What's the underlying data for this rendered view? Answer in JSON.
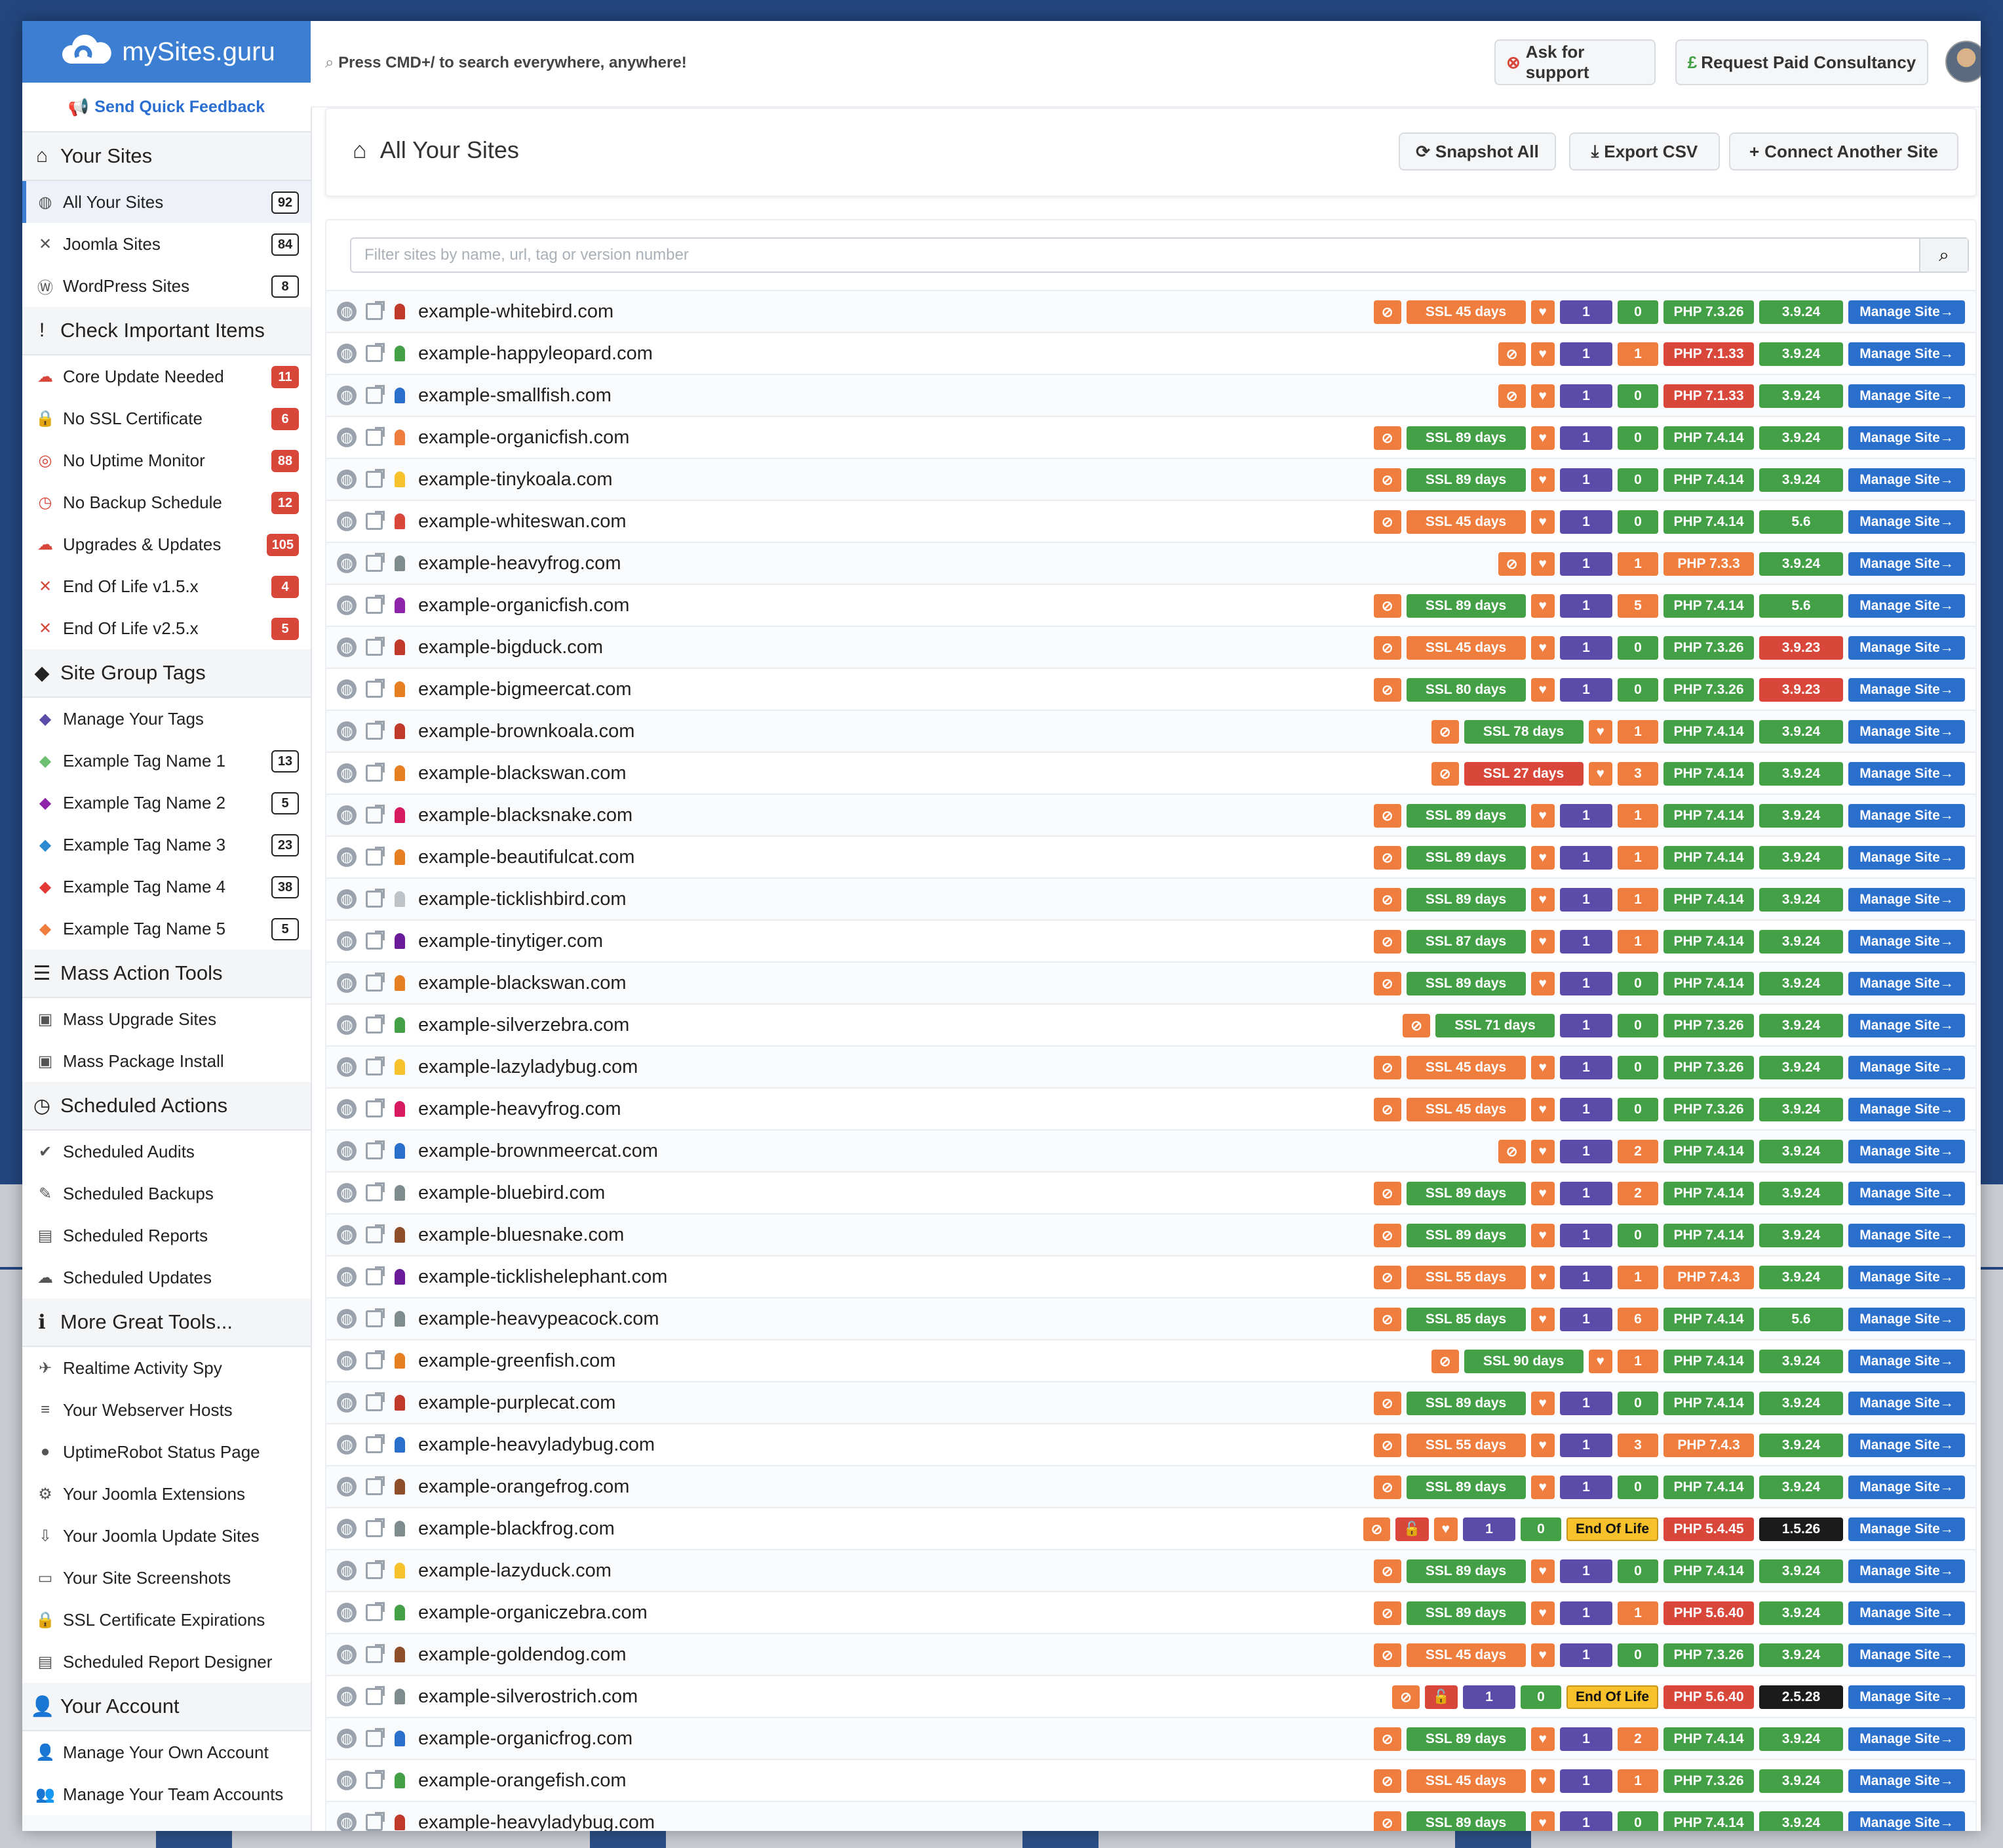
{
  "app": {
    "brand": "mySites.guru",
    "feedback": "Send Quick Feedback",
    "search_hint": "Press CMD+/ to search everywhere, anywhere!",
    "ask_support": "Ask for support",
    "paid_consultancy": "Request Paid Consultancy"
  },
  "sidebar": {
    "sections": [
      {
        "title": "Your Sites",
        "icon": "home-icon",
        "items": [
          {
            "label": "All Your Sites",
            "icon": "globe-icon",
            "count": "92",
            "active": true
          },
          {
            "label": "Joomla Sites",
            "icon": "joomla-icon",
            "count": "84"
          },
          {
            "label": "WordPress Sites",
            "icon": "wordpress-icon",
            "count": "8"
          }
        ]
      },
      {
        "title": "Check Important Items",
        "icon": "exclamation-icon",
        "items": [
          {
            "label": "Core Update Needed",
            "icon": "cloud-up-icon",
            "count": "11",
            "red": true
          },
          {
            "label": "No SSL Certificate",
            "icon": "lock-icon",
            "count": "6",
            "red": true
          },
          {
            "label": "No Uptime Monitor",
            "icon": "target-icon",
            "count": "88",
            "red": true
          },
          {
            "label": "No Backup Schedule",
            "icon": "clock-icon",
            "count": "12",
            "red": true
          },
          {
            "label": "Upgrades & Updates",
            "icon": "cloud-up-icon",
            "count": "105",
            "red": true
          },
          {
            "label": "End Of Life v1.5.x",
            "icon": "joomla-icon",
            "count": "4",
            "red": true
          },
          {
            "label": "End Of Life v2.5.x",
            "icon": "joomla-icon",
            "count": "5",
            "red": true
          }
        ]
      },
      {
        "title": "Site Group Tags",
        "icon": "tags-icon",
        "items": [
          {
            "label": "Manage Your Tags",
            "icon": "tags-icon",
            "color": "#5b4ca9"
          },
          {
            "label": "Example Tag Name 1",
            "icon": "tag-icon",
            "count": "13",
            "color": "#6cc070"
          },
          {
            "label": "Example Tag Name 2",
            "icon": "tag-icon",
            "count": "5",
            "color": "#8e24aa"
          },
          {
            "label": "Example Tag Name 3",
            "icon": "tag-icon",
            "count": "23",
            "color": "#2b8ad0"
          },
          {
            "label": "Example Tag Name 4",
            "icon": "tag-icon",
            "count": "38",
            "color": "#e53935"
          },
          {
            "label": "Example Tag Name 5",
            "icon": "tag-icon",
            "count": "5",
            "color": "#ef7d3d"
          }
        ]
      },
      {
        "title": "Mass Action Tools",
        "icon": "list-icon",
        "items": [
          {
            "label": "Mass Upgrade Sites",
            "icon": "upgrade-icon"
          },
          {
            "label": "Mass Package Install",
            "icon": "package-icon"
          }
        ]
      },
      {
        "title": "Scheduled Actions",
        "icon": "clock-icon",
        "items": [
          {
            "label": "Scheduled Audits",
            "icon": "shield-check-icon"
          },
          {
            "label": "Scheduled Backups",
            "icon": "backup-icon"
          },
          {
            "label": "Scheduled Reports",
            "icon": "report-icon"
          },
          {
            "label": "Scheduled Updates",
            "icon": "cloud-up-icon"
          }
        ]
      },
      {
        "title": "More Great Tools...",
        "icon": "info-icon",
        "items": [
          {
            "label": "Realtime Activity Spy",
            "icon": "telescope-icon"
          },
          {
            "label": "Your Webserver Hosts",
            "icon": "server-icon"
          },
          {
            "label": "UptimeRobot Status Page",
            "icon": "circle-icon"
          },
          {
            "label": "Your Joomla Extensions",
            "icon": "extensions-icon"
          },
          {
            "label": "Your Joomla Update Sites",
            "icon": "update-sites-icon"
          },
          {
            "label": "Your Site Screenshots",
            "icon": "screenshot-icon"
          },
          {
            "label": "SSL Certificate Expirations",
            "icon": "lock-icon"
          },
          {
            "label": "Scheduled Report Designer",
            "icon": "report-icon"
          }
        ]
      },
      {
        "title": "Your Account",
        "icon": "user-icon",
        "items": [
          {
            "label": "Manage Your Own Account",
            "icon": "user-icon"
          },
          {
            "label": "Manage Your Team Accounts",
            "icon": "users-icon"
          }
        ]
      }
    ]
  },
  "main": {
    "title": "All Your Sites",
    "snapshot_all": "Snapshot All",
    "export_csv": "Export CSV",
    "connect": "Connect Another Site",
    "filter_placeholder": "Filter sites by name, url, tag or version number",
    "manage_label": "Manage Site"
  },
  "sites": [
    {
      "url": "example-whitebird.com",
      "pin": "#c0392b",
      "ssl": "SSL 45 days",
      "sslc": "or",
      "tag": "1",
      "ext": "0",
      "extc": "gr",
      "php": "PHP 7.3.26",
      "phpc": "gr",
      "ver": "3.9.24",
      "verc": "gr"
    },
    {
      "url": "example-happyleopard.com",
      "pin": "#43a047",
      "ssl": null,
      "tag": "1",
      "ext": "1",
      "extc": "or",
      "php": "PHP 7.1.33",
      "phpc": "rd",
      "ver": "3.9.24",
      "verc": "gr"
    },
    {
      "url": "example-smallfish.com",
      "pin": "#2b6fcd",
      "ssl": null,
      "tag": "1",
      "ext": "0",
      "extc": "gr",
      "php": "PHP 7.1.33",
      "phpc": "rd",
      "ver": "3.9.24",
      "verc": "gr"
    },
    {
      "url": "example-organicfish.com",
      "pin": "#ef7d3d",
      "ssl": "SSL 89 days",
      "sslc": "gr",
      "tag": "1",
      "ext": "0",
      "extc": "gr",
      "php": "PHP 7.4.14",
      "phpc": "gr",
      "ver": "3.9.24",
      "verc": "gr"
    },
    {
      "url": "example-tinykoala.com",
      "pin": "#f7c12b",
      "ssl": "SSL 89 days",
      "sslc": "gr",
      "tag": "1",
      "ext": "0",
      "extc": "gr",
      "php": "PHP 7.4.14",
      "phpc": "gr",
      "ver": "3.9.24",
      "verc": "gr"
    },
    {
      "url": "example-whiteswan.com",
      "pin": "#d9463a",
      "ssl": "SSL 45 days",
      "sslc": "or",
      "tag": "1",
      "ext": "0",
      "extc": "gr",
      "php": "PHP 7.4.14",
      "phpc": "gr",
      "ver": "5.6",
      "verc": "gr",
      "wp": true
    },
    {
      "url": "example-heavyfrog.com",
      "pin": "#7f8c8d",
      "ssl": null,
      "tag": "1",
      "ext": "1",
      "extc": "or",
      "php": "PHP 7.3.3",
      "phpc": "or",
      "ver": "3.9.24",
      "verc": "gr"
    },
    {
      "url": "example-organicfish.com",
      "pin": "#8e24aa",
      "ssl": "SSL 89 days",
      "sslc": "gr",
      "tag": "1",
      "ext": "5",
      "extc": "or",
      "refresh": true,
      "php": "PHP 7.4.14",
      "phpc": "gr",
      "ver": "5.6",
      "verc": "gr",
      "wp": true
    },
    {
      "url": "example-bigduck.com",
      "pin": "#c0392b",
      "ssl": "SSL 45 days",
      "sslc": "or",
      "tag": "1",
      "ext": "0",
      "extc": "gr",
      "php": "PHP 7.3.26",
      "phpc": "gr",
      "ver": "3.9.23",
      "verc": "rd"
    },
    {
      "url": "example-bigmeercat.com",
      "pin": "#e67e22",
      "ssl": "SSL 80 days",
      "sslc": "gr",
      "tag": "1",
      "ext": "0",
      "extc": "gr",
      "php": "PHP 7.3.26",
      "phpc": "gr",
      "ver": "3.9.23",
      "verc": "rd"
    },
    {
      "url": "example-brownkoala.com",
      "pin": "#c0392b",
      "ssl": "SSL 78 days",
      "sslc": "gr",
      "notag": true,
      "ext": "1",
      "extc": "or",
      "php": "PHP 7.4.14",
      "phpc": "gr",
      "ver": "3.9.24",
      "verc": "gr"
    },
    {
      "url": "example-blackswan.com",
      "pin": "#e67e22",
      "ssl": "SSL 27 days",
      "sslc": "rd",
      "notag": true,
      "ext": "3",
      "extc": "or",
      "php": "PHP 7.4.14",
      "phpc": "gr",
      "ver": "3.9.24",
      "verc": "gr"
    },
    {
      "url": "example-blacksnake.com",
      "pin": "#d81b60",
      "ssl": "SSL 89 days",
      "sslc": "gr",
      "tag": "1",
      "ext": "1",
      "extc": "or",
      "php": "PHP 7.4.14",
      "phpc": "gr",
      "ver": "3.9.24",
      "verc": "gr"
    },
    {
      "url": "example-beautifulcat.com",
      "pin": "#e67e22",
      "ssl": "SSL 89 days",
      "sslc": "gr",
      "tag": "1",
      "ext": "1",
      "extc": "or",
      "php": "PHP 7.4.14",
      "phpc": "gr",
      "ver": "3.9.24",
      "verc": "gr"
    },
    {
      "url": "example-ticklishbird.com",
      "pin": "#bdc3c7",
      "ssl": "SSL 89 days",
      "sslc": "gr",
      "tag": "1",
      "ext": "1",
      "extc": "or",
      "php": "PHP 7.4.14",
      "phpc": "gr",
      "ver": "3.9.24",
      "verc": "gr"
    },
    {
      "url": "example-tinytiger.com",
      "pin": "#6a1b9a",
      "ssl": "SSL 87 days",
      "sslc": "gr",
      "tag": "1",
      "ext": "1",
      "extc": "or",
      "php": "PHP 7.4.14",
      "phpc": "gr",
      "ver": "3.9.24",
      "verc": "gr"
    },
    {
      "url": "example-blackswan.com",
      "pin": "#e67e22",
      "ssl": "SSL 89 days",
      "sslc": "gr",
      "tag": "1",
      "ext": "0",
      "extc": "gr",
      "php": "PHP 7.4.14",
      "phpc": "gr",
      "ver": "3.9.24",
      "verc": "gr"
    },
    {
      "url": "example-silverzebra.com",
      "pin": "#43a047",
      "ssl": "SSL 71 days",
      "sslc": "gr",
      "noheart": true,
      "tag": "1",
      "ext": "0",
      "extc": "gr",
      "php": "PHP 7.3.26",
      "phpc": "gr",
      "ver": "3.9.24",
      "verc": "gr"
    },
    {
      "url": "example-lazyladybug.com",
      "pin": "#f7c12b",
      "ssl": "SSL 45 days",
      "sslc": "or",
      "tag": "1",
      "ext": "0",
      "extc": "gr",
      "php": "PHP 7.3.26",
      "phpc": "gr",
      "ver": "3.9.24",
      "verc": "gr"
    },
    {
      "url": "example-heavyfrog.com",
      "pin": "#d81b60",
      "ssl": "SSL 45 days",
      "sslc": "or",
      "tag": "1",
      "ext": "0",
      "extc": "gr",
      "php": "PHP 7.3.26",
      "phpc": "gr",
      "ver": "3.9.24",
      "verc": "gr"
    },
    {
      "url": "example-brownmeercat.com",
      "pin": "#2b6fcd",
      "ssl": null,
      "tag": "1",
      "ext": "2",
      "extc": "or",
      "php": "PHP 7.4.14",
      "phpc": "gr",
      "ver": "3.9.24",
      "verc": "gr"
    },
    {
      "url": "example-bluebird.com",
      "pin": "#7f8c8d",
      "ssl": "SSL 89 days",
      "sslc": "gr",
      "tag": "1",
      "ext": "2",
      "extc": "or",
      "php": "PHP 7.4.14",
      "phpc": "gr",
      "ver": "3.9.24",
      "verc": "gr"
    },
    {
      "url": "example-bluesnake.com",
      "pin": "#8d4f2a",
      "ssl": "SSL 89 days",
      "sslc": "gr",
      "tag": "1",
      "ext": "0",
      "extc": "gr",
      "php": "PHP 7.4.14",
      "phpc": "gr",
      "ver": "3.9.24",
      "verc": "gr"
    },
    {
      "url": "example-ticklishelephant.com",
      "pin": "#6a1b9a",
      "ssl": "SSL 55 days",
      "sslc": "or",
      "tag": "1",
      "ext": "1",
      "extc": "or",
      "php": "PHP 7.4.3",
      "phpc": "or",
      "ver": "3.9.24",
      "verc": "gr"
    },
    {
      "url": "example-heavypeacock.com",
      "pin": "#7f8c8d",
      "ssl": "SSL 85 days",
      "sslc": "gr",
      "tag": "1",
      "ext": "6",
      "extc": "or",
      "refresh": true,
      "php": "PHP 7.4.14",
      "phpc": "gr",
      "ver": "5.6",
      "verc": "gr",
      "wp": true
    },
    {
      "url": "example-greenfish.com",
      "pin": "#e67e22",
      "ssl": "SSL 90 days",
      "sslc": "gr",
      "notag": true,
      "ext": "1",
      "extc": "or",
      "php": "PHP 7.4.14",
      "phpc": "gr",
      "ver": "3.9.24",
      "verc": "gr"
    },
    {
      "url": "example-purplecat.com",
      "pin": "#c0392b",
      "ssl": "SSL 89 days",
      "sslc": "gr",
      "tag": "1",
      "ext": "0",
      "extc": "gr",
      "php": "PHP 7.4.14",
      "phpc": "gr",
      "ver": "3.9.24",
      "verc": "gr"
    },
    {
      "url": "example-heavyladybug.com",
      "pin": "#2b6fcd",
      "ssl": "SSL 55 days",
      "sslc": "or",
      "tag": "1",
      "ext": "3",
      "extc": "or",
      "php": "PHP 7.4.3",
      "phpc": "or",
      "ver": "3.9.24",
      "verc": "gr"
    },
    {
      "url": "example-orangefrog.com",
      "pin": "#8d4f2a",
      "ssl": "SSL 89 days",
      "sslc": "gr",
      "tag": "1",
      "ext": "0",
      "extc": "gr",
      "php": "PHP 7.4.14",
      "phpc": "gr",
      "ver": "3.9.24",
      "verc": "gr"
    },
    {
      "url": "example-blackfrog.com",
      "pin": "#7f8c8d",
      "ssl": "",
      "sslc": "rd",
      "eol": "End Of Life",
      "tag": "1",
      "ext": "0",
      "extc": "gr",
      "php": "PHP 5.4.45",
      "phpc": "rd",
      "ver": "1.5.26",
      "verc": "bk"
    },
    {
      "url": "example-lazyduck.com",
      "pin": "#f7c12b",
      "ssl": "SSL 89 days",
      "sslc": "gr",
      "tag": "1",
      "ext": "0",
      "extc": "gr",
      "php": "PHP 7.4.14",
      "phpc": "gr",
      "ver": "3.9.24",
      "verc": "gr"
    },
    {
      "url": "example-organiczebra.com",
      "pin": "#43a047",
      "ssl": "SSL 89 days",
      "sslc": "gr",
      "tag": "1",
      "ext": "1",
      "extc": "or",
      "php": "PHP 5.6.40",
      "phpc": "rd",
      "ver": "3.9.24",
      "verc": "gr"
    },
    {
      "url": "example-goldendog.com",
      "pin": "#8d4f2a",
      "ssl": "SSL 45 days",
      "sslc": "or",
      "tag": "1",
      "ext": "0",
      "extc": "gr",
      "php": "PHP 7.3.26",
      "phpc": "gr",
      "ver": "3.9.24",
      "verc": "gr"
    },
    {
      "url": "example-silverostrich.com",
      "pin": "#7f8c8d",
      "ssl": "",
      "sslc": "rd",
      "noheart": true,
      "eol": "End Of Life",
      "tag": "1",
      "ext": "0",
      "extc": "gr",
      "php": "PHP 5.6.40",
      "phpc": "rd",
      "ver": "2.5.28",
      "verc": "bk"
    },
    {
      "url": "example-organicfrog.com",
      "pin": "#2b6fcd",
      "ssl": "SSL 89 days",
      "sslc": "gr",
      "tag": "1",
      "ext": "2",
      "extc": "or",
      "php": "PHP 7.4.14",
      "phpc": "gr",
      "ver": "3.9.24",
      "verc": "gr"
    },
    {
      "url": "example-orangefish.com",
      "pin": "#43a047",
      "ssl": "SSL 45 days",
      "sslc": "or",
      "tag": "1",
      "ext": "1",
      "extc": "or",
      "php": "PHP 7.3.26",
      "phpc": "gr",
      "ver": "3.9.24",
      "verc": "gr"
    },
    {
      "url": "example-heavyladybug.com",
      "pin": "#c0392b",
      "ssl": "SSL 89 days",
      "sslc": "gr",
      "tag": "1",
      "ext": "0",
      "extc": "gr",
      "php": "PHP 7.4.14",
      "phpc": "gr",
      "ver": "3.9.24",
      "verc": "gr"
    }
  ]
}
